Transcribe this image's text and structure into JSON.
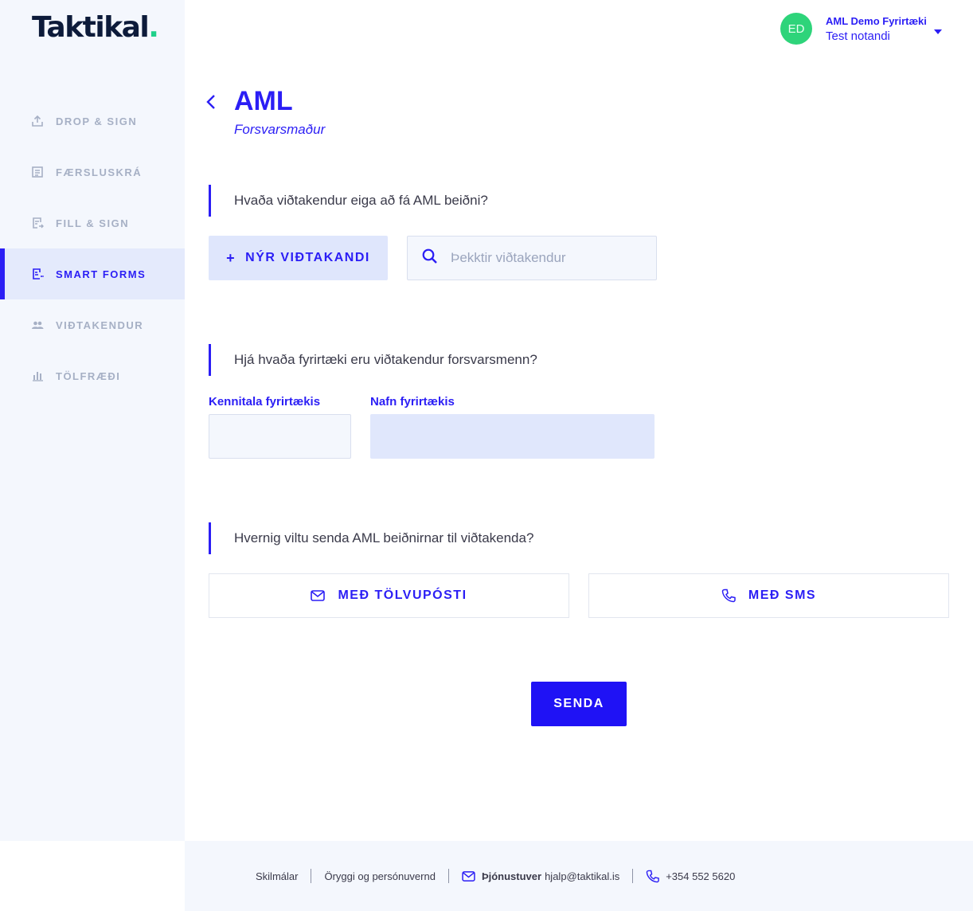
{
  "app": {
    "logo_text": "Taktikal",
    "logo_dot": "."
  },
  "colors": {
    "accent": "#2b1ef5",
    "brand_green": "#1fd08a",
    "avatar": "#2ed47a"
  },
  "sidebar": {
    "items": [
      {
        "label": "DROP & SIGN",
        "icon": "upload-icon",
        "active": false
      },
      {
        "label": "FÆRSLUSKRÁ",
        "icon": "document-list-icon",
        "active": false
      },
      {
        "label": "FILL & SIGN",
        "icon": "fill-document-icon",
        "active": false
      },
      {
        "label": "SMART FORMS",
        "icon": "smart-form-icon",
        "active": true
      },
      {
        "label": "VIÐTAKENDUR",
        "icon": "people-icon",
        "active": false
      },
      {
        "label": "TÖLFRÆÐI",
        "icon": "bar-chart-icon",
        "active": false
      }
    ]
  },
  "user": {
    "initials": "ED",
    "company": "AML Demo Fyrirtæki",
    "name": "Test notandi"
  },
  "page": {
    "title": "AML",
    "subtitle": "Forsvarsmaður"
  },
  "recipients": {
    "question": "Hvaða viðtakendur eiga að fá AML beiðni?",
    "new_button_plus": "+",
    "new_button": "NÝR VIÐTAKANDI",
    "search_placeholder": "Þekktir viðtakendur",
    "search_value": ""
  },
  "company": {
    "question": "Hjá hvaða fyrirtæki eru viðtakendur forsvarsmenn?",
    "kennitala_label": "Kennitala fyrirtækis",
    "kennitala_value": "",
    "name_label": "Nafn fyrirtækis",
    "name_value": ""
  },
  "delivery": {
    "question": "Hvernig viltu senda AML beiðnirnar til viðtakenda?",
    "email_label": "MEÐ TÖLVUPÓSTI",
    "sms_label": "MEÐ SMS"
  },
  "send_button": "SENDA",
  "footer": {
    "terms": "Skilmálar",
    "privacy": "Öryggi og persónuvernd",
    "support_label": "Þjónustuver",
    "support_email": "hjalp@taktikal.is",
    "phone": "+354 552 5620"
  }
}
